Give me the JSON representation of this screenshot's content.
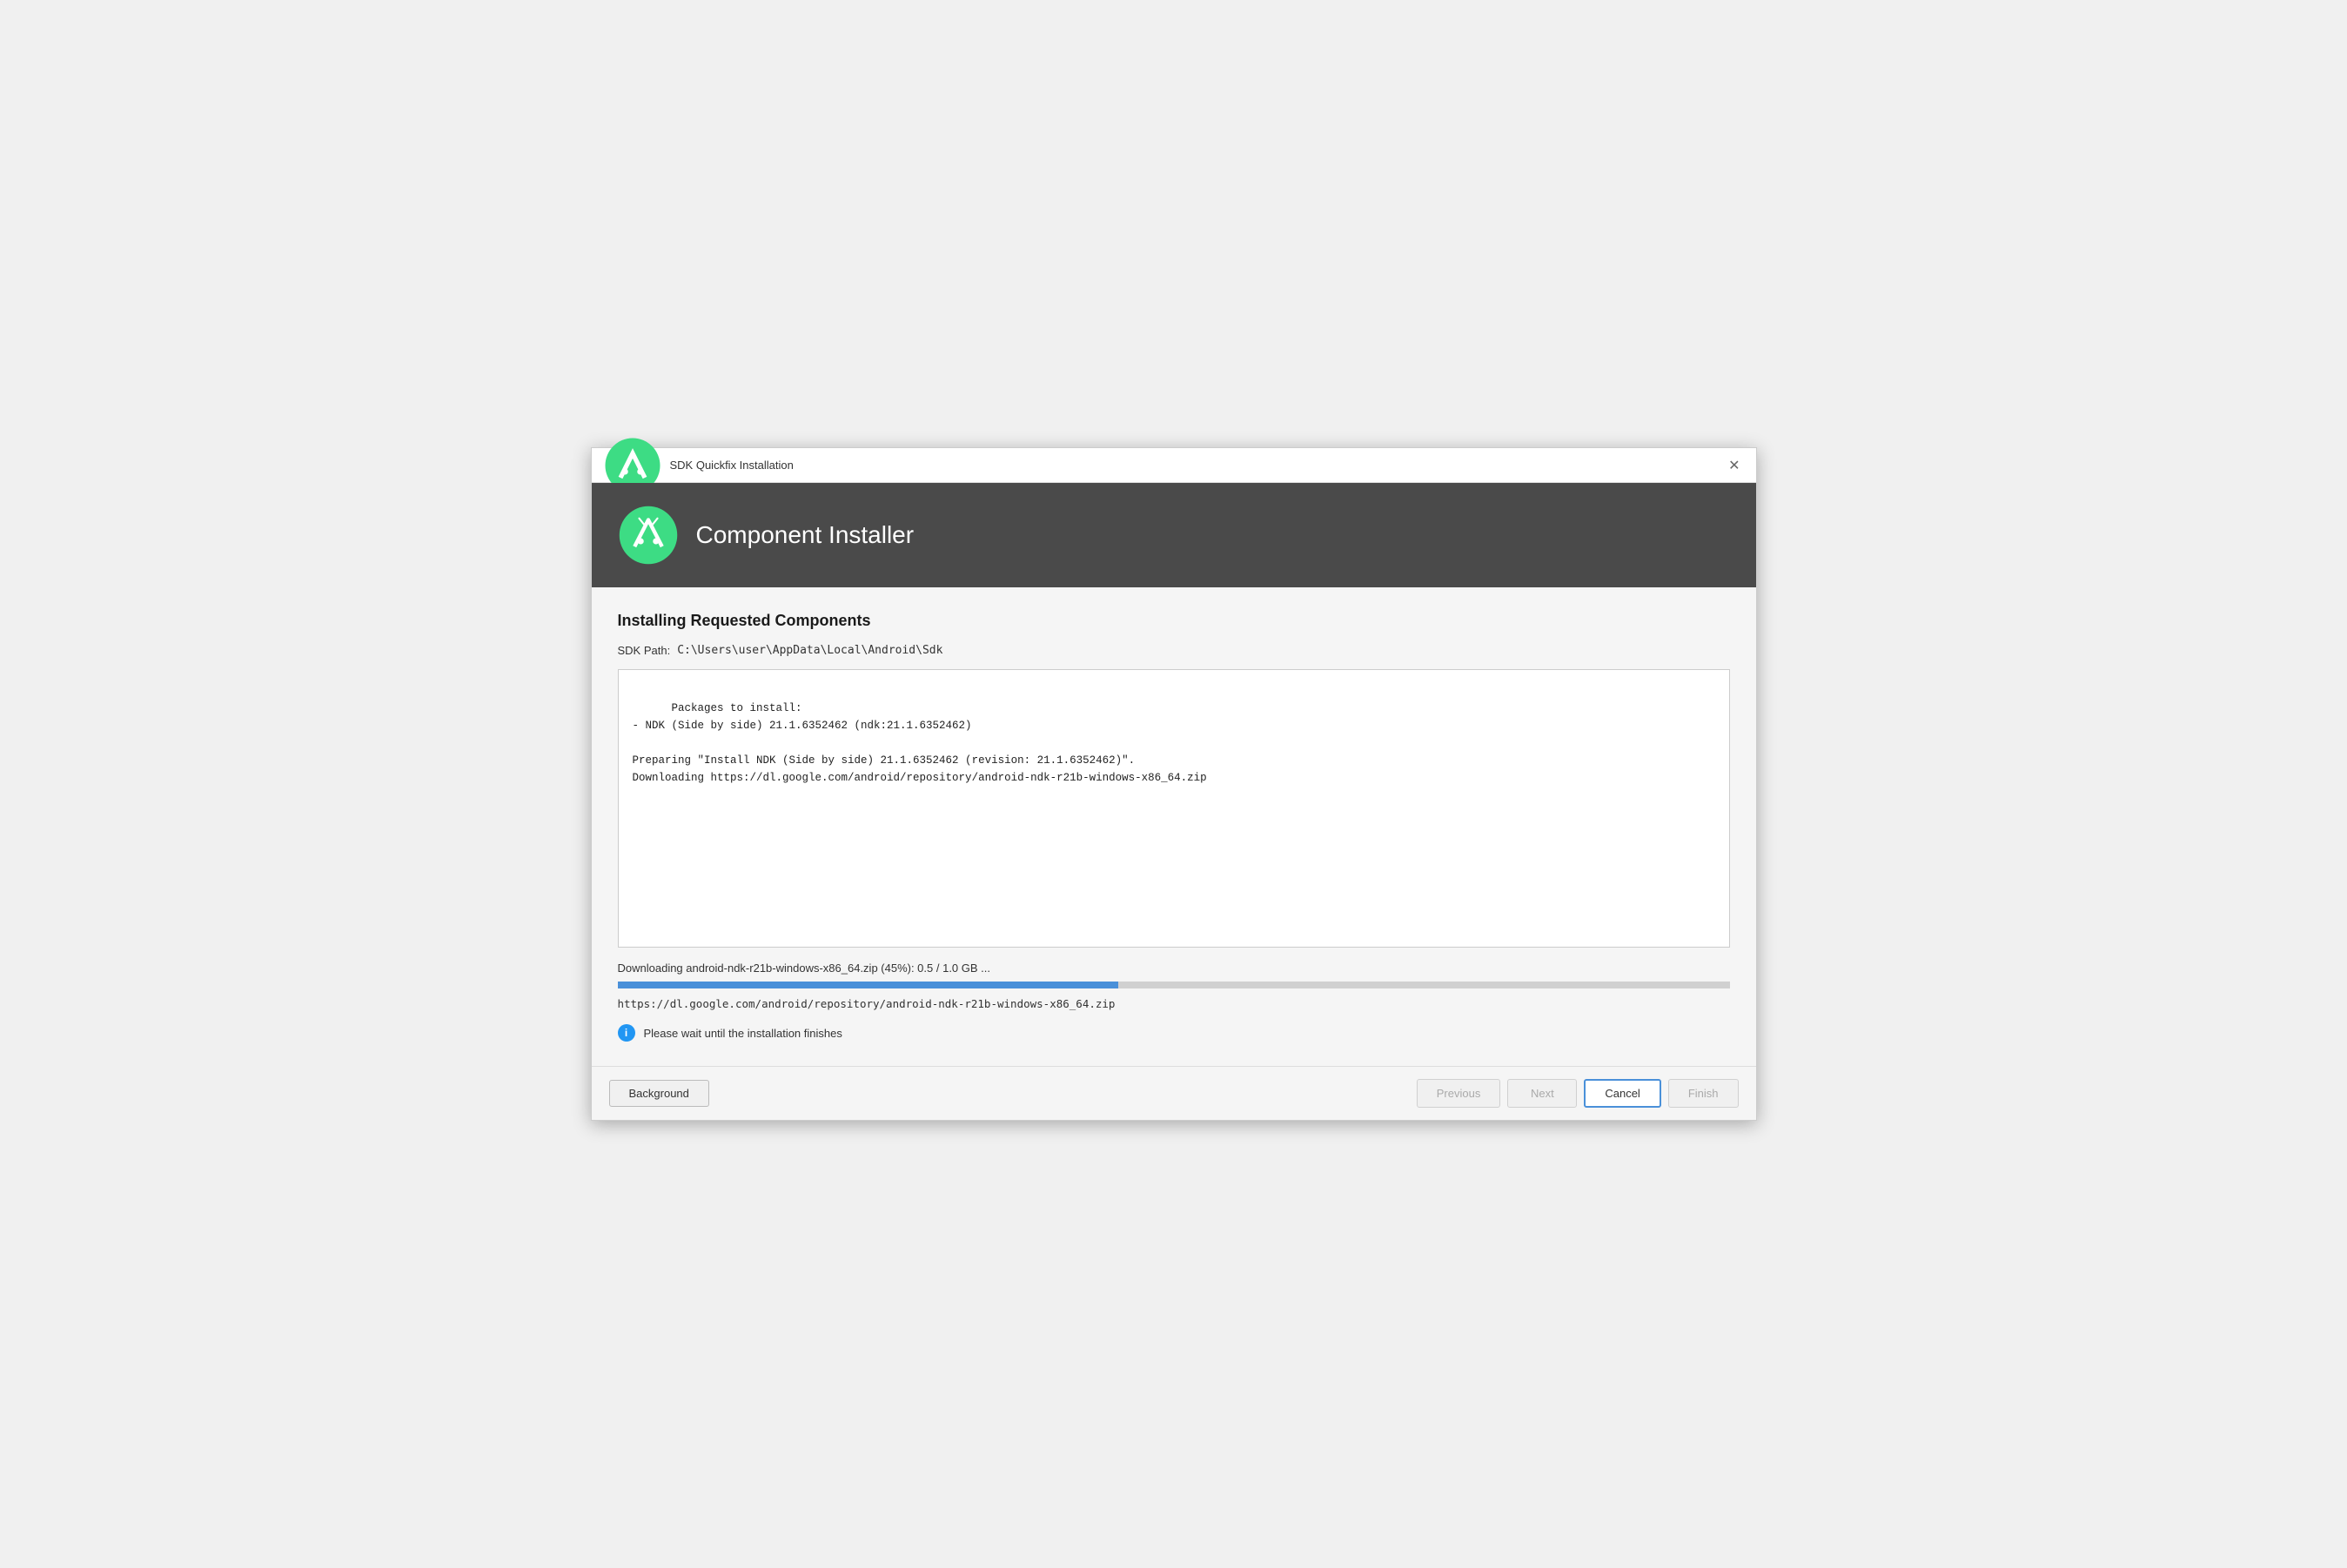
{
  "titleBar": {
    "icon": "android-studio-icon",
    "title": "SDK Quickfix Installation",
    "closeLabel": "✕"
  },
  "header": {
    "title": "Component Installer"
  },
  "content": {
    "sectionTitle": "Installing Requested Components",
    "sdkPathLabel": "SDK Path:",
    "sdkPathValue": "C:\\Users\\user\\AppData\\Local\\Android\\Sdk",
    "logContent": "Packages to install:\n- NDK (Side by side) 21.1.6352462 (ndk:21.1.6352462)\n\nPreparing \"Install NDK (Side by side) 21.1.6352462 (revision: 21.1.6352462)\".\nDownloading https://dl.google.com/android/repository/android-ndk-r21b-windows-x86_64.zip",
    "downloadStatus": "Downloading android-ndk-r21b-windows-x86_64.zip (45%): 0.5 / 1.0 GB ...",
    "progressPercent": 45,
    "downloadUrl": "https://dl.google.com/android/repository/android-ndk-r21b-windows-x86_64.zip",
    "infoMessage": "Please wait until the installation finishes"
  },
  "footer": {
    "backgroundLabel": "Background",
    "previousLabel": "Previous",
    "nextLabel": "Next",
    "cancelLabel": "Cancel",
    "finishLabel": "Finish"
  }
}
